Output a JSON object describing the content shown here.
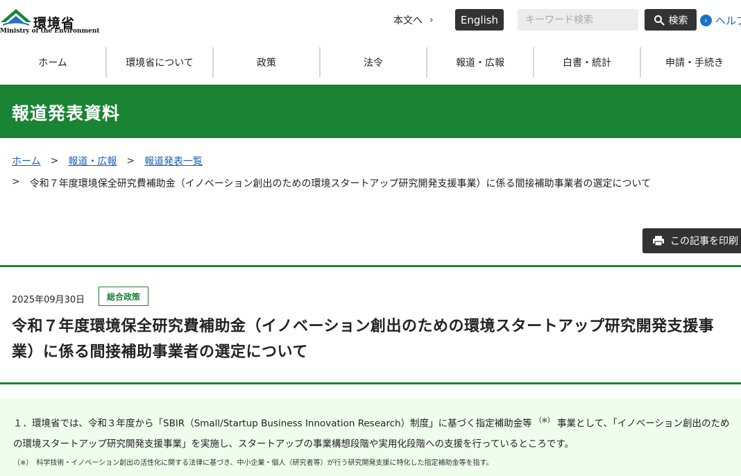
{
  "header": {
    "logo_ja": "環境省",
    "logo_en": "Ministry of the Environment",
    "skip_link": "本文へ",
    "english_button": "English",
    "search_placeholder": "キーワード検索",
    "search_button": "検索",
    "help_link": "ヘルプ"
  },
  "nav": {
    "items": [
      {
        "label": "ホーム"
      },
      {
        "label": "環境省について"
      },
      {
        "label": "政策"
      },
      {
        "label": "法令"
      },
      {
        "label": "報道・広報"
      },
      {
        "label": "白書・統計"
      },
      {
        "label": "申請・手続き"
      }
    ]
  },
  "band": {
    "title": "報道発表資料"
  },
  "breadcrumb": {
    "home": "ホーム",
    "press": "報道・広報",
    "press_list": "報道発表一覧",
    "current": "令和７年度環境保全研究費補助金（イノベーション創出のための環境スタートアップ研究開発支援事業）に係る間接補助事業者の選定について"
  },
  "print_button": "この記事を印刷",
  "article": {
    "date": "2025年09月30日",
    "tag": "総合政策",
    "title": "令和７年度環境保全研究費補助金（イノベーション創出のための環境スタートアップ研究開発支援事業）に係る間接補助事業者の選定について",
    "summary_part1": "１．環境省では、令和３年度から「SBIR（Small/Startup Business Innovation Research）制度」に基づく指定補助金等",
    "summary_sup": "（※）",
    "summary_part2": "事業として、「イノベーション創出のための環境スタートアップ研究開発支援事業」を実施し、スタートアップの事業構想段階や実用化段階への支援を行っているところです。",
    "note": "（※）　科学技術・イノベーション創出の活性化に関する法律に基づき、中小企業・個人（研究者等）が行う研究開発支援に特化した指定補助金等を指す。"
  },
  "colors": {
    "brand_green": "#1a8434",
    "dark_button": "#333333",
    "link_blue": "#1a5fb4",
    "summary_bg": "#eefdec"
  },
  "icons": [
    "logo-mark-icon",
    "chevron-right-icon",
    "search-icon",
    "help-arrow-icon",
    "printer-icon"
  ]
}
